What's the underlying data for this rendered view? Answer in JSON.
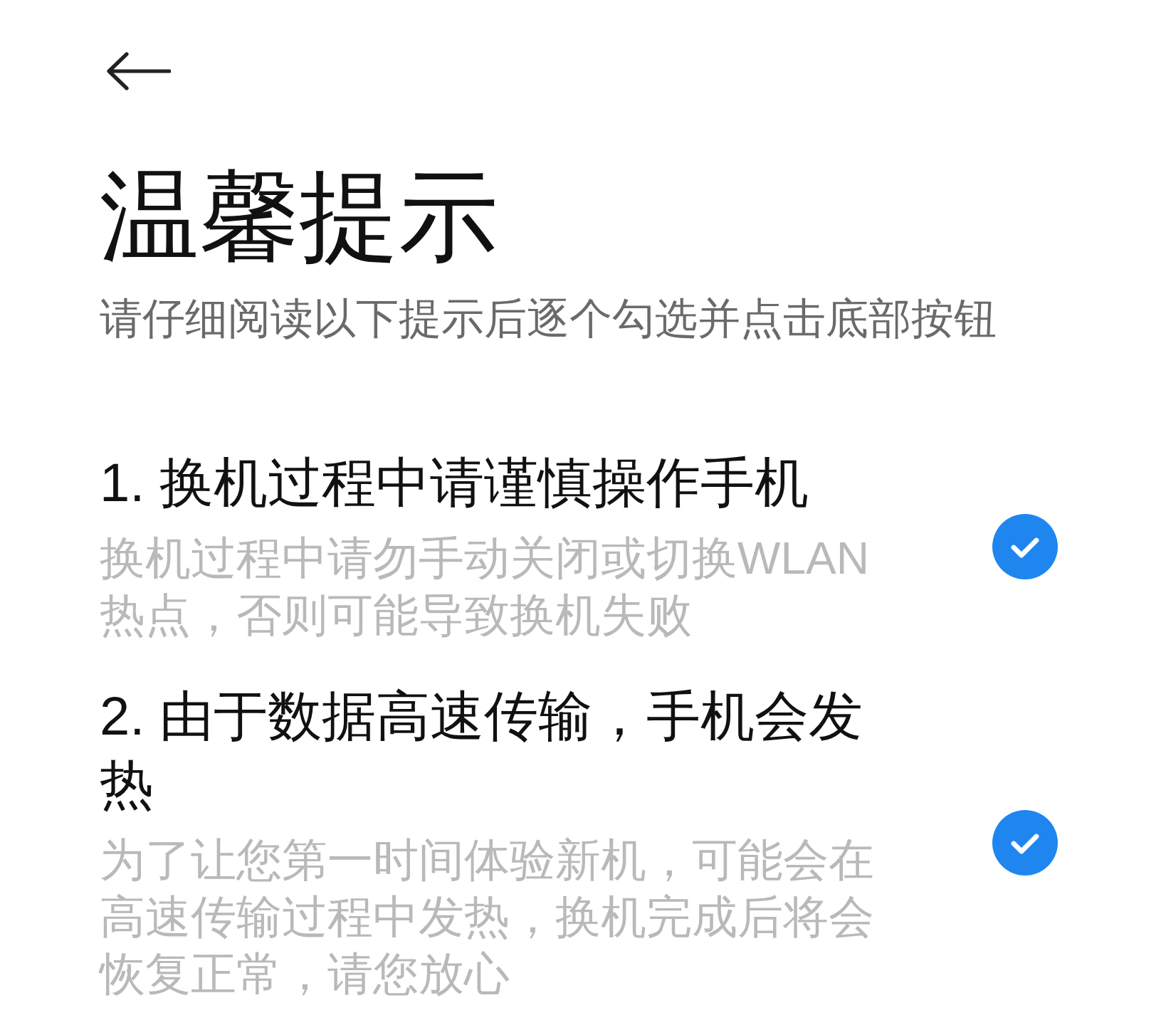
{
  "title": "温馨提示",
  "subtitle": "请仔细阅读以下提示后逐个勾选并点击底部按钮",
  "items": [
    {
      "heading": "1. 换机过程中请谨慎操作手机",
      "description": "换机过程中请勿手动关闭或切换WLAN热点，否则可能导致换机失败",
      "checked": true
    },
    {
      "heading": "2. 由于数据高速传输，手机会发热",
      "description": "为了让您第一时间体验新机，可能会在高速传输过程中发热，换机完成后将会恢复正常，请您放心",
      "checked": true
    }
  ]
}
